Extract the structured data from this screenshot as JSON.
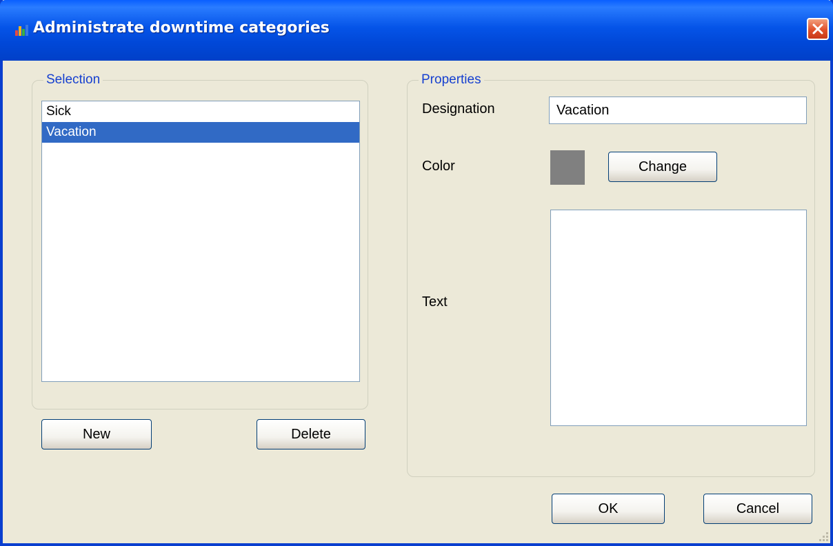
{
  "window": {
    "title": "Administrate downtime categories",
    "icon": "app-chart-icon",
    "close_icon": "close-icon",
    "title_color": "#0554e8",
    "close_color": "#e0502a"
  },
  "selection": {
    "legend": "Selection",
    "items": [
      {
        "label": "Sick",
        "selected": false
      },
      {
        "label": "Vacation",
        "selected": true
      }
    ],
    "new_label": "New",
    "delete_label": "Delete"
  },
  "properties": {
    "legend": "Properties",
    "designation_label": "Designation",
    "designation_value": "Vacation",
    "color_label": "Color",
    "color_value": "#808080",
    "change_label": "Change",
    "text_label": "Text",
    "text_value": ""
  },
  "footer": {
    "ok_label": "OK",
    "cancel_label": "Cancel"
  }
}
